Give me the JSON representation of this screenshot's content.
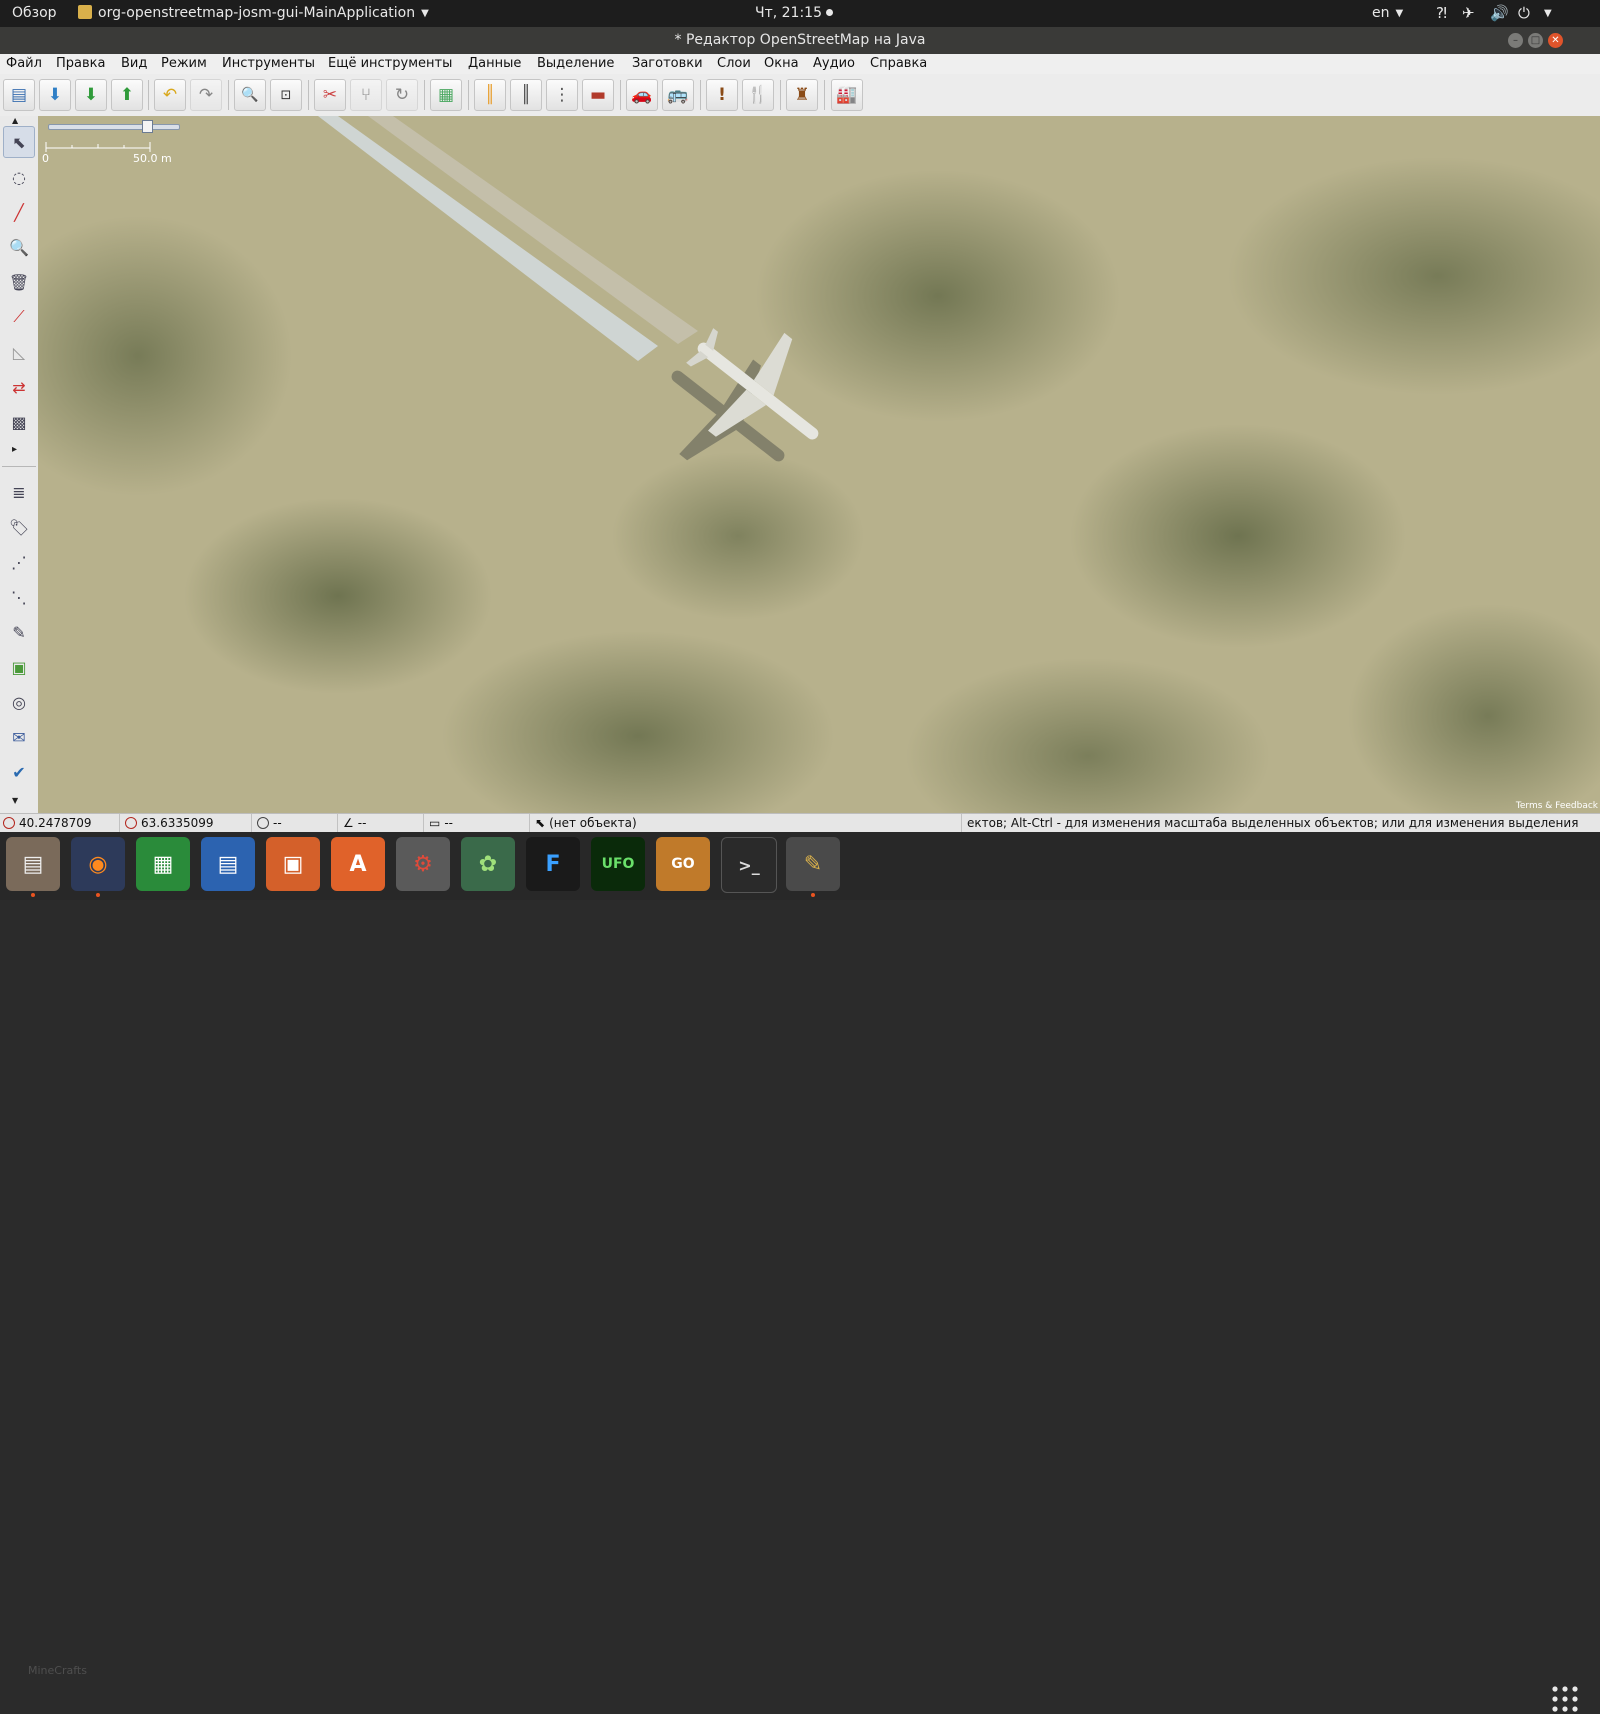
{
  "topbar": {
    "overview": "Обзор",
    "app": "org-openstreetmap-josm-gui-MainApplication",
    "clock": "Чт, 21:15",
    "lang": "en"
  },
  "window": {
    "title": "* Редактор OpenStreetMap на Java"
  },
  "menu": [
    "Файл",
    "Правка",
    "Вид",
    "Режим",
    "Инструменты",
    "Ещё инструменты",
    "Данные",
    "Выделение",
    "Заготовки",
    "Слои",
    "Окна",
    "Аудио",
    "Справка"
  ],
  "map": {
    "scale_zero": "0",
    "scale_label": "50.0 m",
    "terms": "Terms & Feedback"
  },
  "status": {
    "lat": "40.2478709",
    "lon": "63.6335099",
    "heading": "--",
    "angle": "--",
    "distance": "--",
    "object": "(нет объекта)",
    "hint": "ектов; Alt-Ctrl - для изменения масштаба выделенных объектов; или для изменения выделения"
  },
  "dock": {
    "ghost_text": "MineCrafts"
  }
}
